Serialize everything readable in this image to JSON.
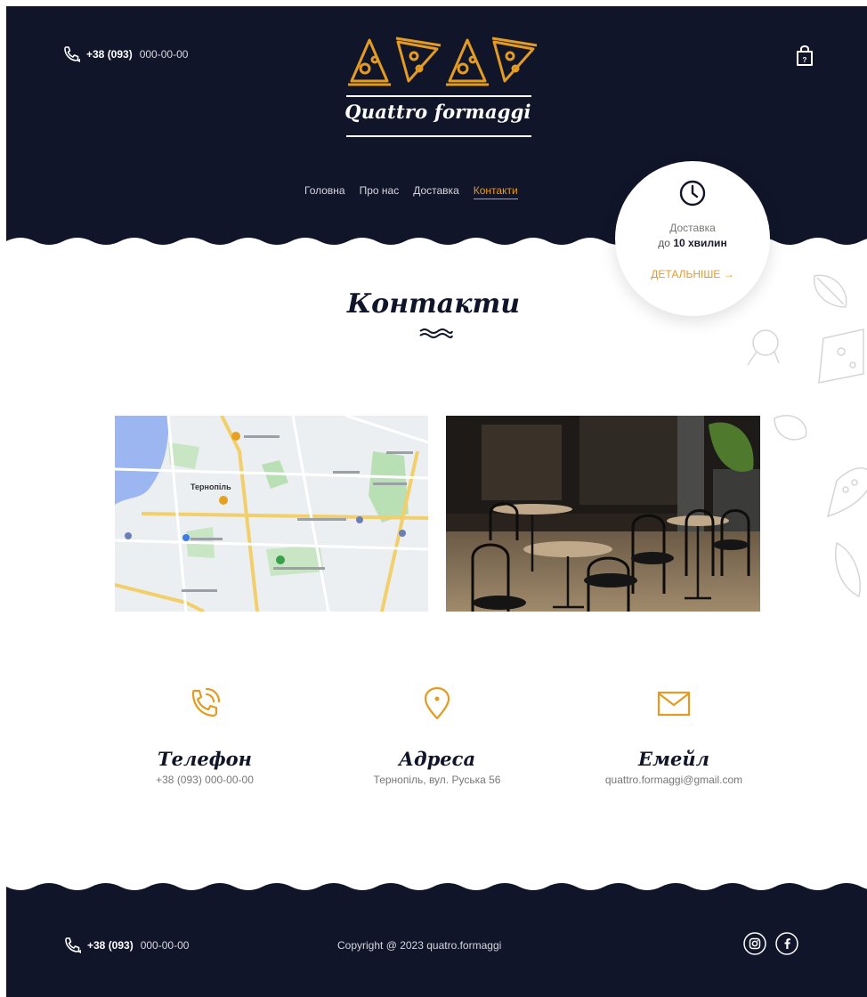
{
  "colors": {
    "navy": "#111529",
    "accent": "#e49b21",
    "white": "#ffffff",
    "muted_text": "#777777"
  },
  "header": {
    "phone_bold": "+38 (093)",
    "phone_rest": "000-00-00",
    "logo_text": "Quattro formaggi",
    "cart_icon": "shopping-bag-icon"
  },
  "nav": {
    "items": [
      {
        "label": "Головна",
        "active": false
      },
      {
        "label": "Про нас",
        "active": false
      },
      {
        "label": "Доставка",
        "active": false
      },
      {
        "label": "Контакти",
        "active": true
      }
    ]
  },
  "delivery": {
    "icon": "clock-icon",
    "line1": "Доставка",
    "line2_prefix": "до",
    "line2_bold": "10 хвилин",
    "more_label": "ДЕТАЛЬНІШЕ",
    "more_arrow": "→"
  },
  "section": {
    "title": "Контакти"
  },
  "map": {
    "city_label": "Тернопіль"
  },
  "contacts": [
    {
      "icon": "phone-call-icon",
      "title": "Телефон",
      "value": "+38 (093) 000-00-00"
    },
    {
      "icon": "location-pin-icon",
      "title": "Адреса",
      "value": "Тернопіль, вул. Руська 56"
    },
    {
      "icon": "mail-icon",
      "title": "Емейл",
      "value": "quattro.formaggi@gmail.com"
    }
  ],
  "footer": {
    "phone_bold": "+38 (093)",
    "phone_rest": "000-00-00",
    "copyright": "Copyright @ 2023 quatro.formaggi",
    "social": [
      "instagram-icon",
      "facebook-icon"
    ]
  }
}
